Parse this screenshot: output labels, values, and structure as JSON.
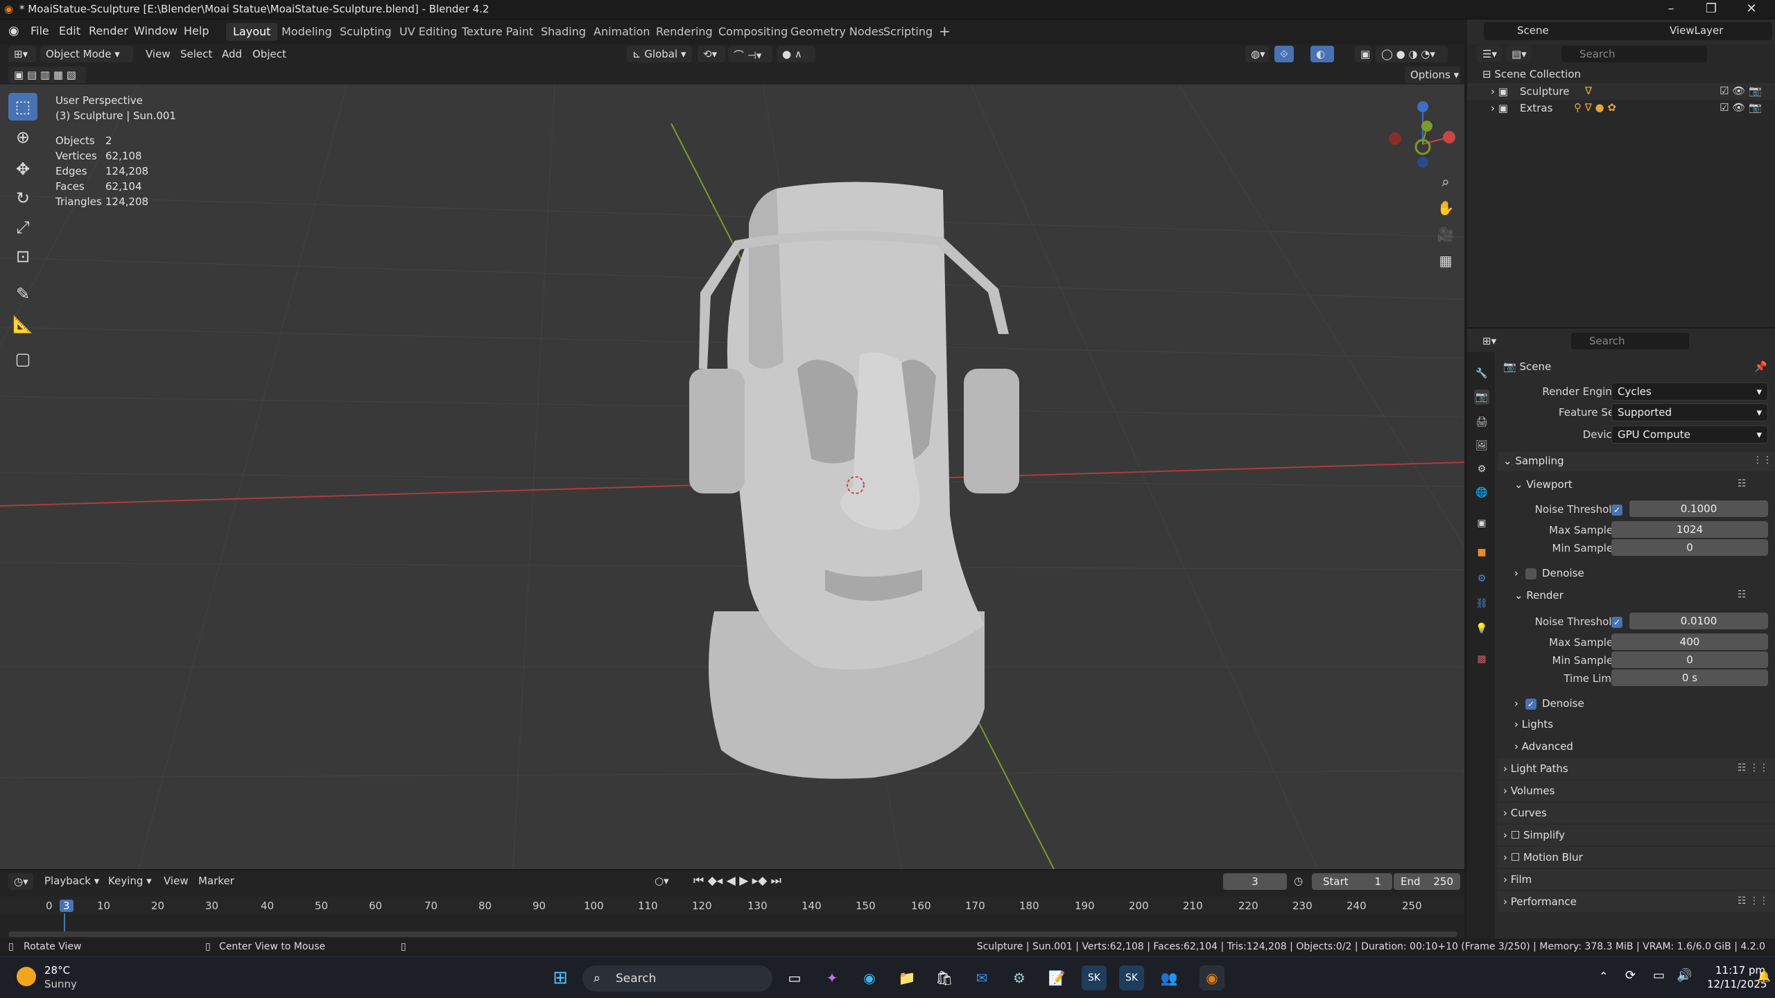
{
  "window": {
    "title": "* MoaiStatue-Sculpture [E:\\Blender\\Moai Statue\\MoaiStatue-Sculpture.blend] - Blender 4.2"
  },
  "menus": [
    "File",
    "Edit",
    "Render",
    "Window",
    "Help"
  ],
  "workspaces": [
    "Layout",
    "Modeling",
    "Sculpting",
    "UV Editing",
    "Texture Paint",
    "Shading",
    "Animation",
    "Rendering",
    "Compositing",
    "Geometry Nodes",
    "Scripting"
  ],
  "scene_selector": {
    "scene": "Scene",
    "view_layer": "ViewLayer"
  },
  "viewport_header": {
    "mode": "Object Mode",
    "menus": [
      "View",
      "Select",
      "Add",
      "Object"
    ],
    "transform": "Global",
    "options": "Options"
  },
  "viewport_overlay": {
    "perspective": "User Perspective",
    "context": "(3) Sculpture | Sun.001",
    "stats": [
      {
        "label": "Objects",
        "value": "2"
      },
      {
        "label": "Vertices",
        "value": "62,108"
      },
      {
        "label": "Edges",
        "value": "124,208"
      },
      {
        "label": "Faces",
        "value": "62,104"
      },
      {
        "label": "Triangles",
        "value": "124,208"
      }
    ]
  },
  "outliner": {
    "search_placeholder": "Search",
    "root": "Scene Collection",
    "items": [
      "Sculpture",
      "Extras"
    ]
  },
  "properties": {
    "search_placeholder": "Search",
    "context": "Scene",
    "render_engine_label": "Render Engine",
    "render_engine": "Cycles",
    "feature_set_label": "Feature Set",
    "feature_set": "Supported",
    "device_label": "Device",
    "device": "GPU Compute",
    "sampling": "Sampling",
    "viewport": "Viewport",
    "vp_noise_label": "Noise Threshold",
    "vp_noise": "0.1000",
    "vp_max_label": "Max Samples",
    "vp_max": "1024",
    "vp_min_label": "Min Samples",
    "vp_min": "0",
    "denoise": "Denoise",
    "render": "Render",
    "r_noise_label": "Noise Threshold",
    "r_noise": "0.0100",
    "r_max_label": "Max Samples",
    "r_max": "400",
    "r_min_label": "Min Samples",
    "r_min": "0",
    "r_time_label": "Time Limit",
    "r_time": "0 s",
    "r_denoise": "Denoise",
    "lights": "Lights",
    "advanced": "Advanced",
    "panels": [
      "Light Paths",
      "Volumes",
      "Curves",
      "Simplify",
      "Motion Blur",
      "Film",
      "Performance"
    ]
  },
  "timeline": {
    "menus": [
      "Playback",
      "Keying",
      "View",
      "Marker"
    ],
    "current_frame": "3",
    "start_label": "Start",
    "start": "1",
    "end_label": "End",
    "end": "250",
    "ruler": [
      "0",
      "10",
      "20",
      "30",
      "40",
      "50",
      "60",
      "70",
      "80",
      "90",
      "100",
      "110",
      "120",
      "130",
      "140",
      "150",
      "160",
      "170",
      "180",
      "190",
      "200",
      "210",
      "220",
      "230",
      "240",
      "250"
    ]
  },
  "statusbar": {
    "left1": "Rotate View",
    "left2": "Center View to Mouse",
    "right": "Sculpture | Sun.001 | Verts:62,108 | Faces:62,104 | Tris:124,208 | Objects:0/2 | Duration: 00:10+10 (Frame 3/250) | Memory: 378.3 MiB | VRAM: 1.6/6.0 GiB | 4.2.0"
  },
  "taskbar": {
    "weather_temp": "28°C",
    "weather_desc": "Sunny",
    "search": "Search",
    "time": "11:17 pm",
    "date": "12/11/2025"
  },
  "colors": {
    "accent": "#4772b3",
    "x_axis": "#b03a3a",
    "y_axis": "#7a9a2a"
  }
}
